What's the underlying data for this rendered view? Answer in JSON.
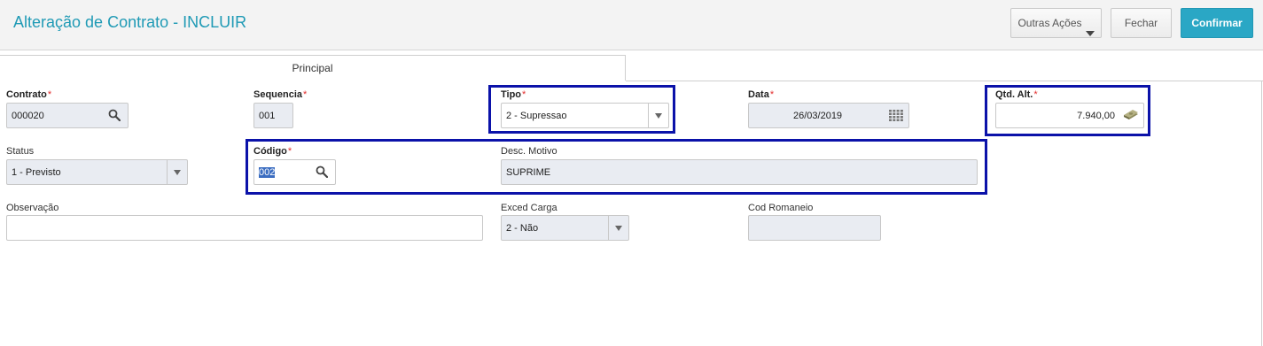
{
  "header": {
    "title": "Alteração de Contrato - INCLUIR",
    "buttons": {
      "outras": "Outras Ações",
      "fechar": "Fechar",
      "confirmar": "Confirmar"
    }
  },
  "tabs": [
    "Principal"
  ],
  "form": {
    "contrato": {
      "label": "Contrato",
      "value": "000020"
    },
    "sequencia": {
      "label": "Sequencia",
      "value": "001"
    },
    "tipo": {
      "label": "Tipo",
      "value": "2 - Supressao"
    },
    "data": {
      "label": "Data",
      "value": "26/03/2019"
    },
    "qtd": {
      "label": "Qtd. Alt.",
      "value": "7.940,00"
    },
    "status": {
      "label": "Status",
      "value": "1 - Previsto"
    },
    "codigo": {
      "label": "Código",
      "value": "002"
    },
    "desc_motivo": {
      "label": "Desc. Motivo",
      "value": "SUPRIME"
    },
    "observacao": {
      "label": "Observação",
      "value": ""
    },
    "exced_carga": {
      "label": "Exced Carga",
      "value": "2 - Não"
    },
    "cod_romaneio": {
      "label": "Cod Romaneio",
      "value": ""
    },
    "required_mark": "*"
  },
  "highlight_color": "#0b12a9",
  "accent_color": "#1f9ab5",
  "icons": [
    "search-icon",
    "calendar-icon",
    "money-icon",
    "chevron-down-icon"
  ]
}
